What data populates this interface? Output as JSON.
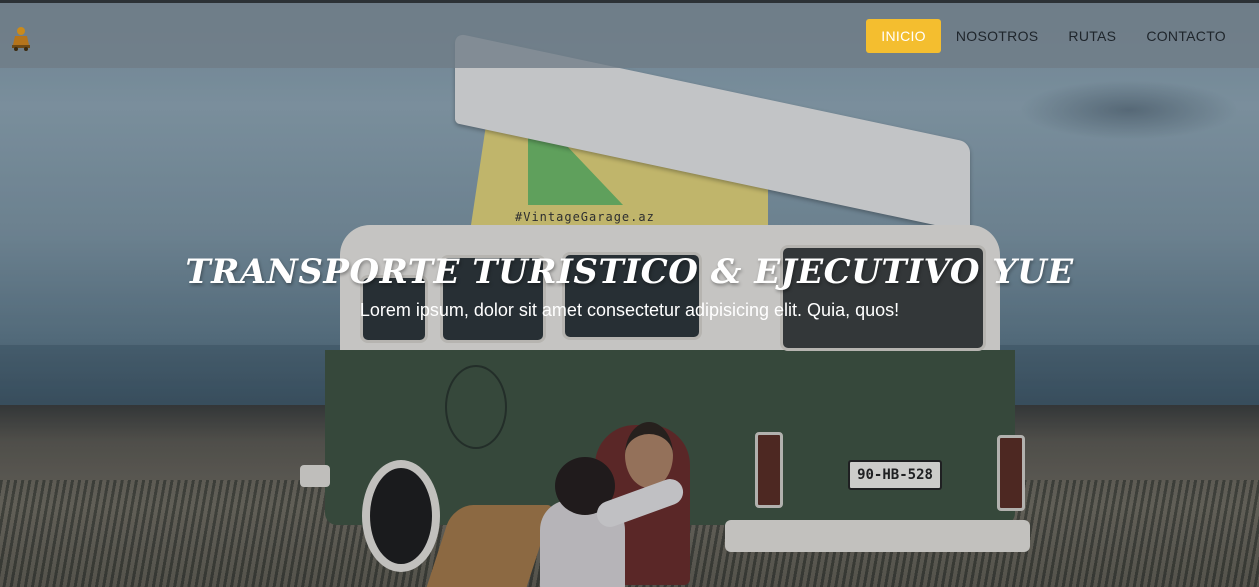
{
  "brand": {
    "logo_icon": "van-logo-icon"
  },
  "nav": {
    "items": [
      {
        "label": "INICIO",
        "active": true
      },
      {
        "label": "NOSOTROS",
        "active": false
      },
      {
        "label": "RUTAS",
        "active": false
      },
      {
        "label": "CONTACTO",
        "active": false
      }
    ]
  },
  "hero": {
    "title": "TRANSPORTE TURISTICO & EJECUTIVO YUE",
    "subtitle": "Lorem ipsum, dolor sit amet consectetur adipisicing elit. Quia, quos!",
    "image": {
      "tent_tag": "#VintageGarage.az",
      "plate": "90-HB-528"
    }
  },
  "colors": {
    "accent": "#f4be2f",
    "navbar": "#707c86"
  }
}
